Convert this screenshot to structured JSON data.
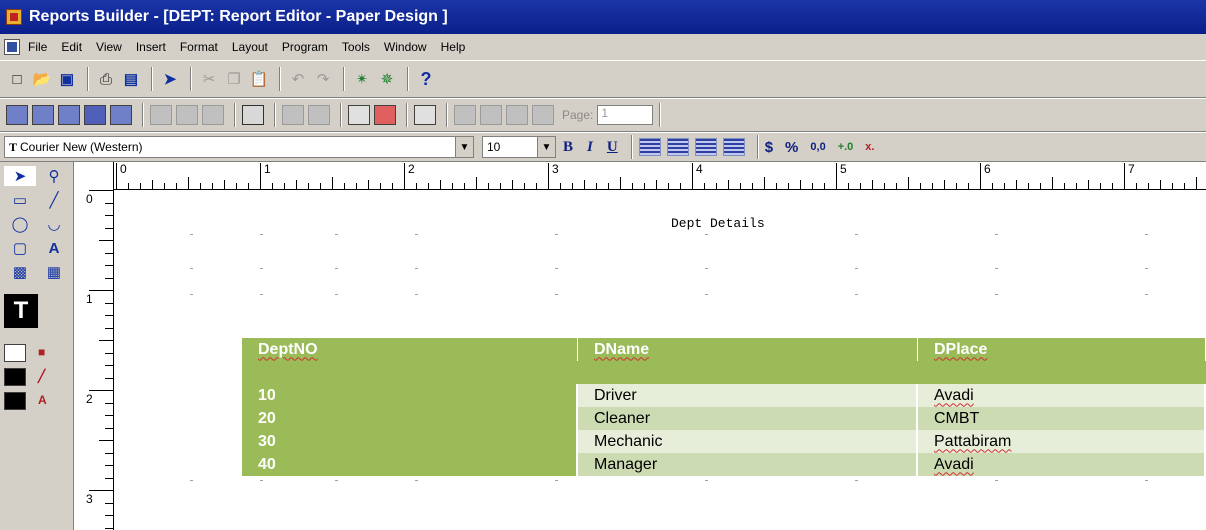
{
  "window": {
    "title": "Reports Builder - [DEPT: Report Editor - Paper Design ]"
  },
  "menu": {
    "items": [
      "File",
      "Edit",
      "View",
      "Insert",
      "Format",
      "Layout",
      "Program",
      "Tools",
      "Window",
      "Help"
    ]
  },
  "toolbar": {
    "help_label": "?",
    "page_label": "Page:",
    "page_value": "1",
    "font_name": "Courier New (Western)",
    "font_size": "10",
    "bold_label": "B",
    "italic_label": "I",
    "underline_label": "U",
    "currency_label": "$",
    "percent_label": "%",
    "comma_label": "0,0",
    "add_decimal_label": "+.0",
    "remove_decimal_label": "x."
  },
  "palette": {
    "text_tool_label": "T",
    "label_tool_label": "A"
  },
  "rulers": {
    "horizontal_numbers": [
      "0",
      "1",
      "2",
      "3",
      "4",
      "5",
      "6",
      "7"
    ],
    "vertical_numbers": [
      "0",
      "1",
      "2",
      "3"
    ]
  },
  "report": {
    "title": "Dept Details",
    "columns": [
      "DeptNO",
      "DName",
      "DPlace"
    ],
    "rows": [
      [
        "10",
        "Driver",
        "Avadi"
      ],
      [
        "20",
        "Cleaner",
        "CMBT"
      ],
      [
        "30",
        "Mechanic",
        "Pattabiram"
      ],
      [
        "40",
        "Manager",
        "Avadi"
      ]
    ]
  },
  "colors": {
    "header_green": "#9bbb59",
    "row_light": "#e6edd9",
    "row_mid": "#cddbb3",
    "titlebar": "#0a1f8a"
  }
}
